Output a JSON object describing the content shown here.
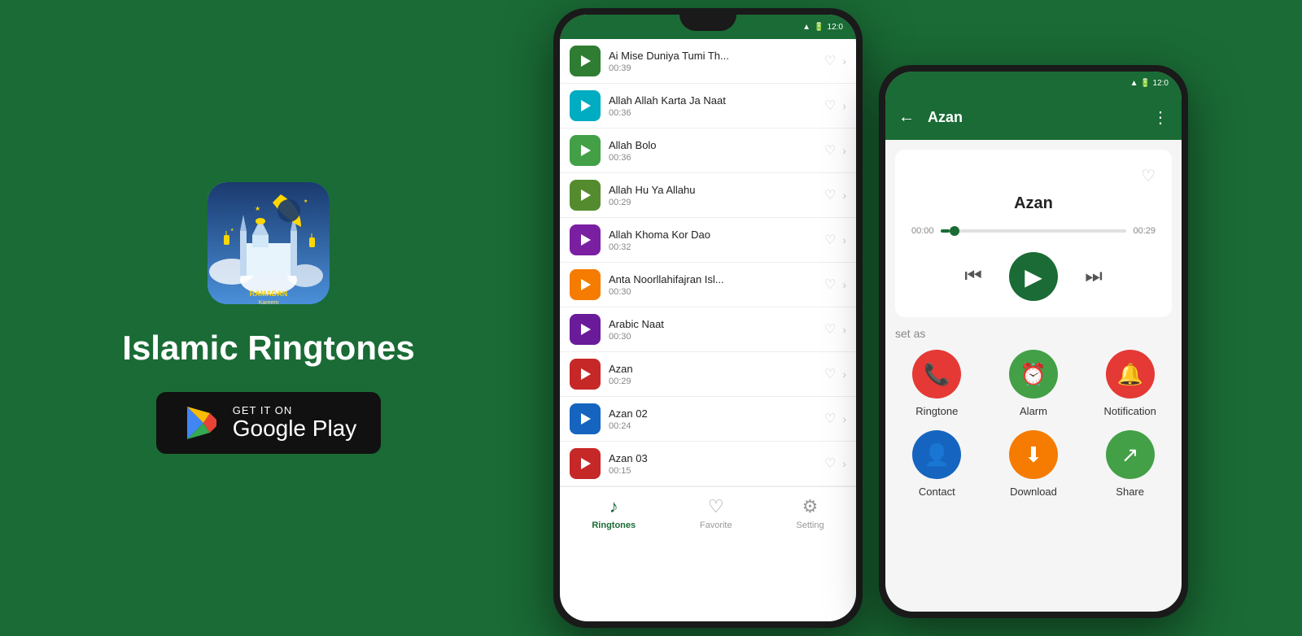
{
  "background": "#1a6b35",
  "left": {
    "app_title": "Islamic Ringtones",
    "google_play": {
      "get_it_on": "GET IT ON",
      "store_name": "Google Play"
    }
  },
  "phone1": {
    "status": {
      "time": "12:0",
      "icons": "▲ 🔋"
    },
    "songs": [
      {
        "name": "Ai Mise Duniya Tumi Th...",
        "duration": "00:39",
        "color": "#2e7d32"
      },
      {
        "name": "Allah Allah Karta Ja Naat",
        "duration": "00:36",
        "color": "#00acc1"
      },
      {
        "name": "Allah Bolo",
        "duration": "00:36",
        "color": "#43a047"
      },
      {
        "name": "Allah Hu Ya Allahu",
        "duration": "00:29",
        "color": "#558b2f"
      },
      {
        "name": "Allah Khoma Kor Dao",
        "duration": "00:32",
        "color": "#7b1fa2"
      },
      {
        "name": "Anta Noorllahifajran Isl...",
        "duration": "00:30",
        "color": "#f57c00"
      },
      {
        "name": "Arabic Naat",
        "duration": "00:30",
        "color": "#6a1b9a"
      },
      {
        "name": "Azan",
        "duration": "00:29",
        "color": "#c62828"
      },
      {
        "name": "Azan 02",
        "duration": "00:24",
        "color": "#1565c0"
      },
      {
        "name": "Azan 03",
        "duration": "00:15",
        "color": "#c62828"
      }
    ],
    "bottom_nav": [
      {
        "label": "Ringtones",
        "active": true,
        "icon": "♪"
      },
      {
        "label": "Favorite",
        "active": false,
        "icon": "♡"
      },
      {
        "label": "Setting",
        "active": false,
        "icon": "⚙"
      }
    ]
  },
  "phone2": {
    "status": {
      "time": "12:0",
      "icons": "▲ 🔋"
    },
    "header": {
      "back": "←",
      "title": "Azan",
      "more": "⋮"
    },
    "player": {
      "title": "Azan",
      "time_start": "00:00",
      "time_end": "00:29",
      "progress": 5
    },
    "set_as_label": "set as",
    "set_as_items": [
      {
        "label": "Ringtone",
        "icon": "📞",
        "color": "#e53935"
      },
      {
        "label": "Alarm",
        "icon": "⏰",
        "color": "#43a047"
      },
      {
        "label": "Notification",
        "icon": "🔔",
        "color": "#e53935"
      },
      {
        "label": "Contact",
        "icon": "👤",
        "color": "#1565c0"
      },
      {
        "label": "Download",
        "icon": "⬇",
        "color": "#f57c00"
      },
      {
        "label": "Share",
        "icon": "↗",
        "color": "#43a047"
      }
    ]
  }
}
